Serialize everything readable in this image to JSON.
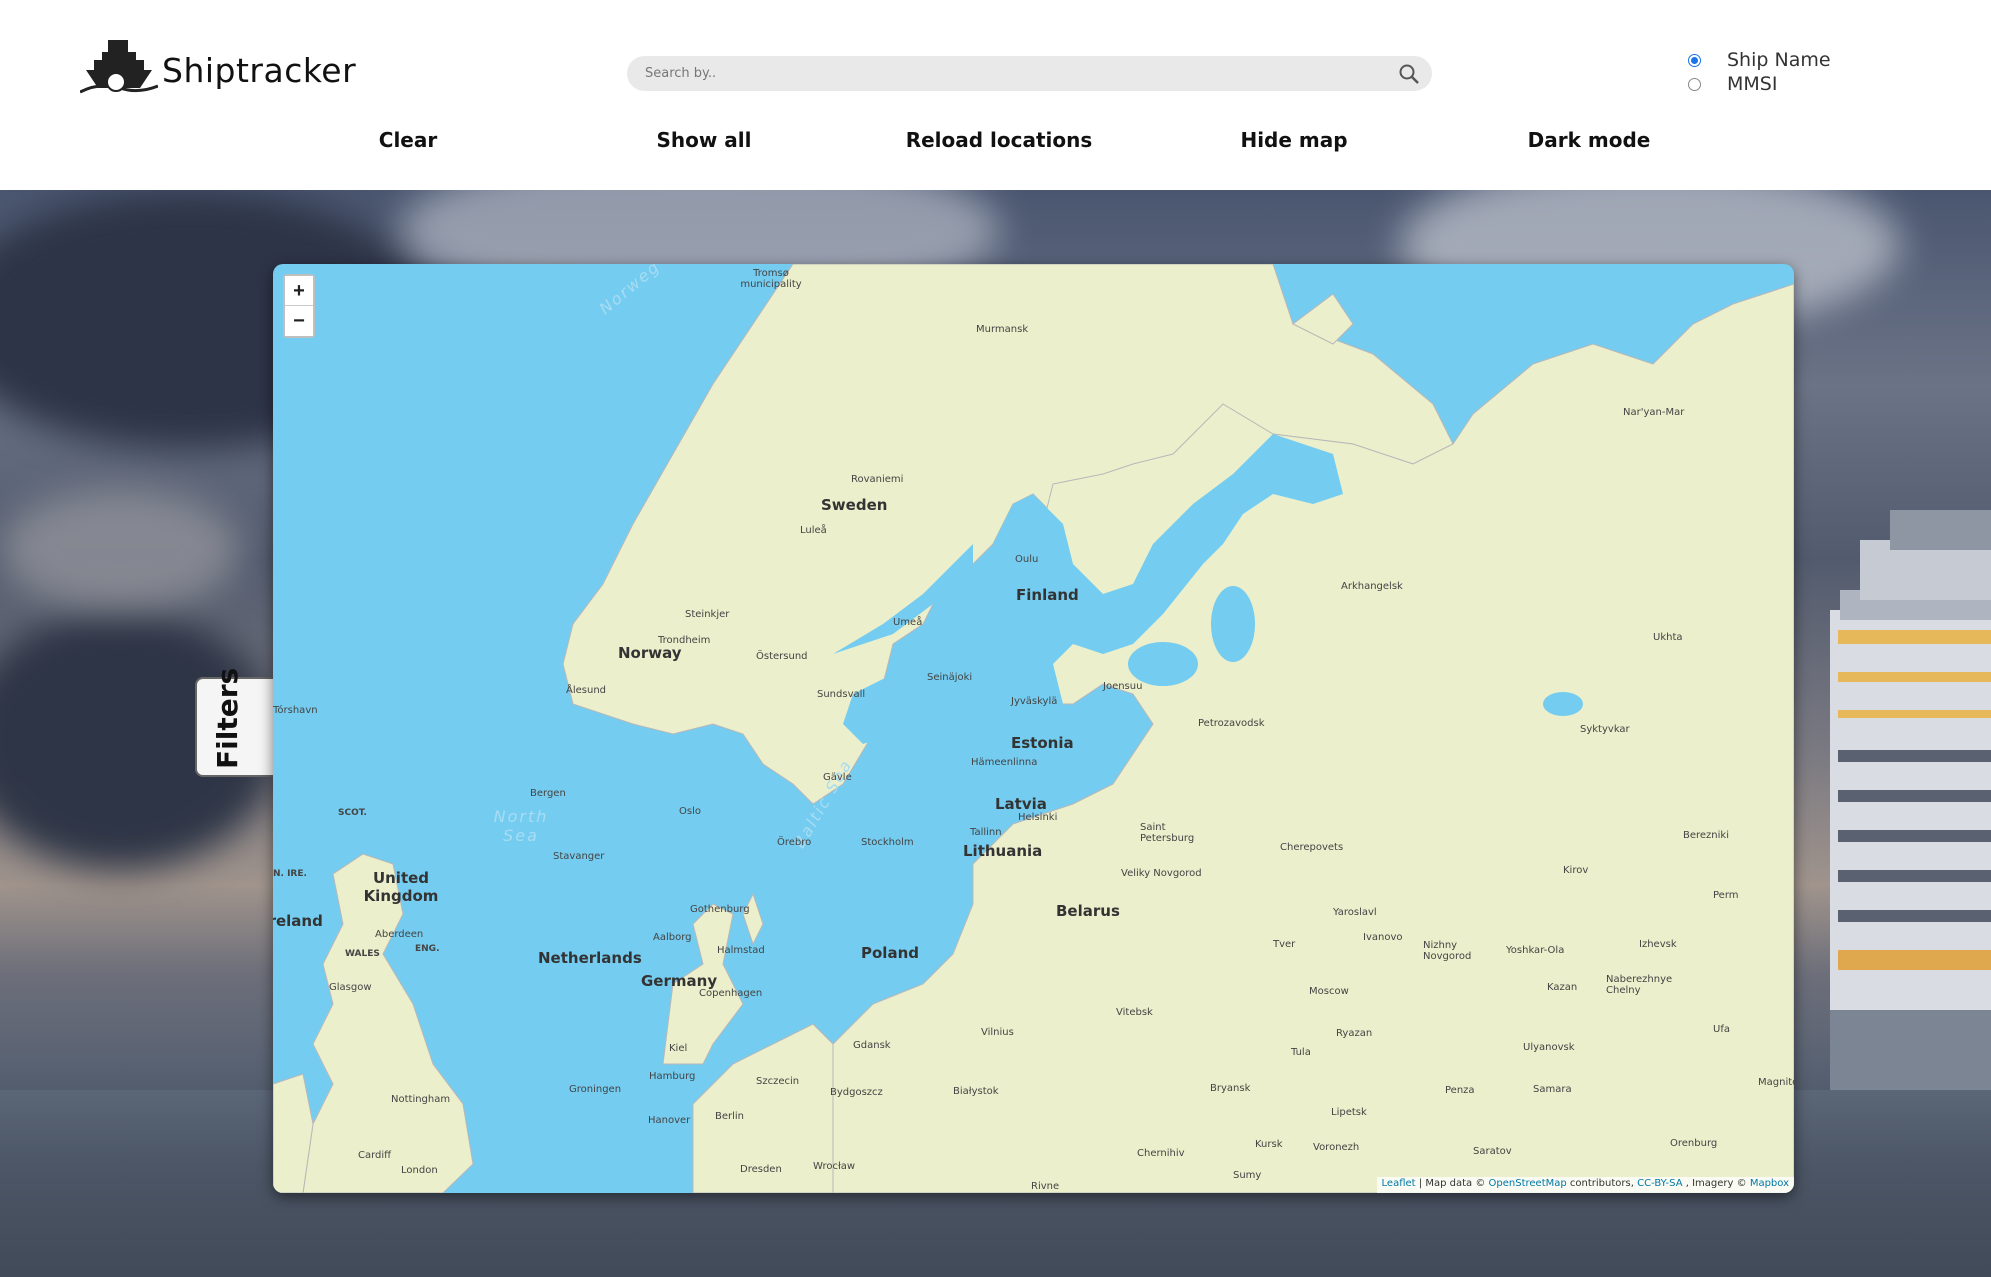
{
  "header": {
    "logo_text": "Shiptracker",
    "search": {
      "placeholder": "Search by..",
      "value": ""
    },
    "search_mode": [
      {
        "label": "Ship Name",
        "checked": true
      },
      {
        "label": "MMSI",
        "checked": false
      }
    ],
    "nav": [
      {
        "id": "clear",
        "label": "Clear"
      },
      {
        "id": "show-all",
        "label": "Show all"
      },
      {
        "id": "reload",
        "label": "Reload locations"
      },
      {
        "id": "hide-map",
        "label": "Hide map"
      },
      {
        "id": "dark-mode",
        "label": "Dark mode"
      }
    ]
  },
  "filters": {
    "label": "Filters"
  },
  "map": {
    "zoom_in": "+",
    "zoom_out": "−",
    "attribution": {
      "leaflet": "Leaflet",
      "map_data": "Map data ©",
      "osm": "OpenStreetMap",
      "contributors": "contributors,",
      "license": "CC-BY-SA",
      "imagery": ", Imagery ©",
      "mapbox": "Mapbox"
    },
    "countries": [
      "Sweden",
      "Finland",
      "Norway",
      "Estonia",
      "Latvia",
      "Lithuania",
      "Belarus",
      "Poland",
      "Germany",
      "Netherlands",
      "United Kingdom"
    ],
    "seas": [
      "Norweg",
      "North Sea",
      "Baltic Sea"
    ],
    "regions": [
      "SCOT.",
      "N. IRE.",
      "ENG.",
      "WALES",
      "Ireland"
    ],
    "cities": [
      "Tromsø municipality",
      "Murmansk",
      "Nar'yan-Mar",
      "Rovaniemi",
      "Luleå",
      "Oulu",
      "Arkhangelsk",
      "Umeå",
      "Ukhta",
      "Steinkjer",
      "Trondheim",
      "Östersund",
      "Seinäjoki",
      "Jyväskylä",
      "Joensuu",
      "Ålesund",
      "Sundsvall",
      "Tórshavn",
      "Petrozavodsk",
      "Syktyvkar",
      "Hämeenlinna",
      "Gävle",
      "Bergen",
      "Oslo",
      "Helsinki",
      "Tallinn",
      "Saint Petersburg",
      "Örebro",
      "Stockholm",
      "Cherepovets",
      "Kirov",
      "Berezniki",
      "Stavanger",
      "Veliky Novgorod",
      "Gothenburg",
      "Perm",
      "Aberdeen",
      "Yaroslavl",
      "Aalborg",
      "Halmstad",
      "Tver",
      "Ivanovo",
      "Nizhny Novgorod",
      "Yoshkar-Ola",
      "Izhevsk",
      "Glasgow",
      "Copenhagen",
      "Moscow",
      "Kazan",
      "Naberezhnye Chelny",
      "Vitebsk",
      "Vilnius",
      "Ryazan",
      "Ufa",
      "Gdansk",
      "Kiel",
      "Tula",
      "Ulyanovsk",
      "Hamburg",
      "Szczecin",
      "Bydgoszcz",
      "Białystok",
      "Bryansk",
      "Penza",
      "Samara",
      "Magnitogorsk",
      "Groningen",
      "Nottingham",
      "Hanover",
      "Berlin",
      "Lipetsk",
      "Cardiff",
      "Kursk",
      "Voronezh",
      "Saratov",
      "Orenburg",
      "London",
      "Dresden",
      "Wrocław",
      "Chernihiv",
      "Sumy",
      "Rivne"
    ]
  }
}
